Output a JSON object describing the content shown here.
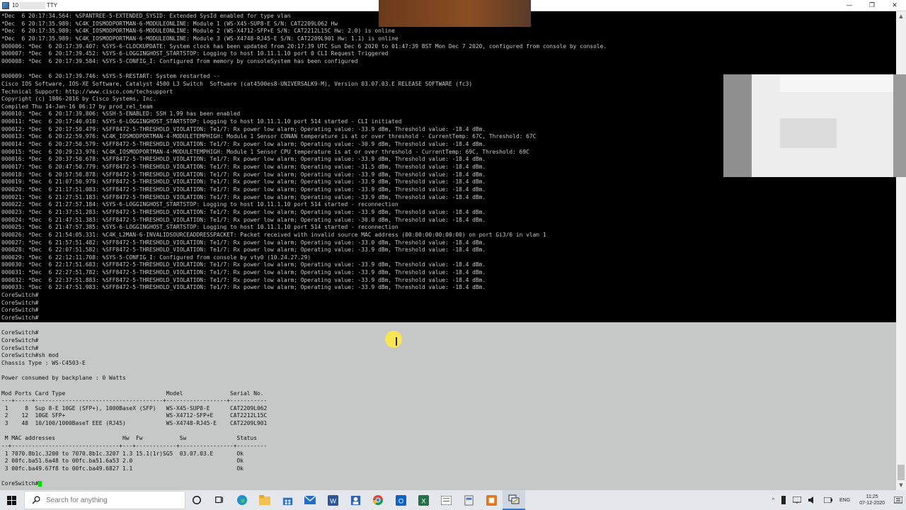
{
  "window": {
    "title_prefix": "10",
    "title_suffix": "TTY",
    "controls": {
      "minimize": "—",
      "maximize": "❐",
      "close": "✕"
    }
  },
  "terminal": {
    "lines": [
      "*Dec  6 20:17:34.564: %SPANTREE-5-EXTENDED_SYSID: Extended SysId enabled for type vlan",
      "*Dec  6 20:17:35.989: %C4K_IOSMODPORTMAN-6-MODULEONLINE: Module 1 (WS-X45-SUP8-E S/N: CAT2209L062 Hw",
      "*Dec  6 20:17:35.989: %C4K_IOSMODPORTMAN-6-MODULEONLINE: Module 2 (WS-X4712-SFP+E S/N: CAT2212L15C Hw: 2.0) is online",
      "*Dec  6 20:17:35.989: %C4K_IOSMODPORTMAN-6-MODULEONLINE: Module 3 (WS-X4748-RJ45-E S/N: CAT2209L901 Hw: 1.1) is online",
      "000006: *Dec  6 20:17:39.407: %SYS-6-CLOCKUPDATE: System clock has been updated from 20:17:39 UTC Sun Dec 6 2020 to 01:47:39 BST Mon Dec 7 2020, configured from console by console.",
      "000007: *Dec  6 20:17:39.452: %SYS-6-LOGGINGHOST_STARTSTOP: Logging to host 10.11.1.10 port 0 CLI Request Triggered",
      "000008: *Dec  6 20:17:39.584: %SYS-5-CONFIG_I: Configured from memory by consoleSystem has been configured",
      "",
      "000009: *Dec  6 20:17:39.746: %SYS-5-RESTART: System restarted --",
      "Cisco IOS Software, IOS-XE Software, Catalyst 4500 L3 Switch  Software (cat4500es8-UNIVERSALK9-M), Version 03.07.03.E RELEASE SOFTWARE (fc3)",
      "Technical Support: http://www.cisco.com/techsupport",
      "Copyright (c) 1986-2016 by Cisco Systems, Inc.",
      "Compiled Thu 14-Jan-16 06:17 by prod_rel_team",
      "000010: *Dec  6 20:17:39.806: %SSH-5-ENABLED: SSH 1.99 has been enabled",
      "000011: *Dec  6 20:17:40.010: %SYS-6-LOGGINGHOST_STARTSTOP: Logging to host 10.11.1.10 port 514 started - CLI initiated",
      "000012: *Dec  6 20:17:50.479: %SFF8472-5-THRESHOLD_VIOLATION: Te1/7: Rx power low alarm; Operating value: -33.9 dBm, Threshold value: -18.4 dBm.",
      "000013: *Dec  6 20:22:59.976: %C4K_IOSMODPORTMAN-4-MODULETEMPHIGH: Module 1 Sensor CONAN temperature is at or over threshold - CurrentTemp: 67C, Threshold: 67C",
      "000014: *Dec  6 20:27:50.579: %SFF8472-5-THRESHOLD_VIOLATION: Te1/7: Rx power low alarm; Operating value: -30.9 dBm, Threshold value: -18.4 dBm.",
      "000015: *Dec  6 20:29:23.976: %C4K_IOSMODPORTMAN-4-MODULETEMPHIGH: Module 1 Sensor CPU temperature is at or over threshold - CurrentTemp: 69C, Threshold: 69C",
      "000016: *Dec  6 20:37:50.678: %SFF8472-5-THRESHOLD_VIOLATION: Te1/7: Rx power low alarm; Operating value: -33.9 dBm, Threshold value: -18.4 dBm.",
      "000017: *Dec  6 20:47:50.779: %SFF8472-5-THRESHOLD_VIOLATION: Te1/7: Rx power low alarm; Operating value: -31.5 dBm, Threshold value: -18.4 dBm.",
      "000018: *Dec  6 20:57:50.878: %SFF8472-5-THRESHOLD_VIOLATION: Te1/7: Rx power low alarm; Operating value: -33.9 dBm, Threshold value: -18.4 dBm.",
      "000019: *Dec  6 21:07:50.979: %SFF8472-5-THRESHOLD_VIOLATION: Te1/7: Rx power low alarm; Operating value: -33.9 dBm, Threshold value: -18.4 dBm.",
      "000020: *Dec  6 21:17:51.083: %SFF8472-5-THRESHOLD_VIOLATION: Te1/7: Rx power low alarm; Operating value: -33.9 dBm, Threshold value: -18.4 dBm.",
      "000021: *Dec  6 21:27:51.183: %SFF8472-5-THRESHOLD_VIOLATION: Te1/7: Rx power low alarm; Operating value: -33.9 dBm, Threshold value: -18.4 dBm.",
      "000022: *Dec  6 21:27:57.184: %SYS-6-LOGGINGHOST_STARTSTOP: Logging to host 10.11.1.10 port 514 started - reconnection",
      "000023: *Dec  6 21:37:51.283: %SFF8472-5-THRESHOLD_VIOLATION: Te1/7: Rx power low alarm; Operating value: -33.9 dBm, Threshold value: -18.4 dBm.",
      "000024: *Dec  6 21:47:51.383: %SFF8472-5-THRESHOLD_VIOLATION: Te1/7: Rx power low alarm; Operating value: -30.0 dBm, Threshold value: -18.4 dBm.",
      "000025: *Dec  6 21:47:57.385: %SYS-6-LOGGINGHOST_STARTSTOP: Logging to host 10.11.1.10 port 514 started - reconnection",
      "000026: *Dec  6 21:54:05.331: %C4K_L2MAN-6-INVALIDSOURCEADDRESSPACKET: Packet received with invalid source MAC address (00:00:00:00:00:00) on port Gi3/6 in vlan 1",
      "000027: *Dec  6 21:57:51.482: %SFF8472-5-THRESHOLD_VIOLATION: Te1/7: Rx power low alarm; Operating value: -33.0 dBm, Threshold value: -18.4 dBm.",
      "000028: *Dec  6 22:07:51.582: %SFF8472-5-THRESHOLD_VIOLATION: Te1/7: Rx power low alarm; Operating value: -33.9 dBm, Threshold value: -18.4 dBm.",
      "000029: *Dec  6 22:12:11.708: %SYS-5-CONFIG_I: Configured from console by vty0 (10.24.27.29)",
      "000030: *Dec  6 22:17:51.683: %SFF8472-5-THRESHOLD_VIOLATION: Te1/7: Rx power low alarm; Operating value: -33.9 dBm, Threshold value: -18.4 dBm.",
      "000031: *Dec  6 22:27:51.782: %SFF8472-5-THRESHOLD_VIOLATION: Te1/7: Rx power low alarm; Operating value: -33.9 dBm, Threshold value: -18.4 dBm.",
      "000032: *Dec  6 22:37:51.883: %SFF8472-5-THRESHOLD_VIOLATION: Te1/7: Rx power low alarm; Operating value: -33.9 dBm, Threshold value: -18.4 dBm.",
      "000033: *Dec  6 22:47:51.983: %SFF8472-5-THRESHOLD_VIOLATION: Te1/7: Rx power low alarm; Operating value: -33.9 dBm, Threshold value: -18.4 dBm.",
      "CoreSwitch#",
      "CoreSwitch#",
      "CoreSwitch#",
      "CoreSwitch#",
      "CoreSwitch#",
      "CoreSwitch#",
      "CoreSwitch#",
      "CoreSwitch#",
      "CoreSwitch#sh mod",
      "Chassis Type : WS-C4503-E",
      "",
      "Power consumed by backplane : 0 Watts",
      "",
      "Mod Ports Card Type                              Model              Serial No.",
      "---+-----+--------------------------------------+------------------+-----------",
      " 1     8  Sup 8-E 10GE (SFP+), 1000BaseX (SFP)   WS-X45-SUP8-E      CAT2209L062",
      " 2    12  10GE SFP+                              WS-X4712-SFP+E     CAT2212L15C",
      " 3    48  10/100/1000BaseT EEE (RJ45)            WS-X4748-RJ45-E    CAT2209L901",
      "",
      " M MAC addresses                    Hw  Fw           Sw               Status",
      "--+--------------------------------+---+------------+----------------+---------",
      " 1 7070.8b1c.3200 to 7070.8b1c.3207 1.3 15.1(1r)SG5  03.07.03.E       Ok",
      " 2 00fc.ba51.6a48 to 00fc.ba51.6a53 2.0                               Ok",
      " 3 00fc.ba49.67f8 to 00fc.ba49.6827 1.1                               Ok",
      "",
      "CoreSwitch#"
    ]
  },
  "scrollbar": {
    "up": "▲",
    "down": "▼"
  },
  "taskbar": {
    "search_placeholder": "Search for anything",
    "icons": [
      "cortana-icon",
      "task-view-icon",
      "edge-icon",
      "file-explorer-icon",
      "store-icon",
      "mail-icon",
      "word-icon",
      "people-icon",
      "chrome-icon",
      "outlook-icon",
      "excel-icon",
      "notes-icon",
      "connection-icon",
      "app-orange-icon",
      "putty-icon"
    ],
    "tray": {
      "chevron": "^",
      "language": "ENG",
      "time": "11:25",
      "date": "07-12-2020"
    }
  },
  "colors": {
    "terminal_bg": "#000000",
    "terminal_fg": "#c8c8c8",
    "selection": "#c6c8c8",
    "cursor": "#00e000",
    "taskbar": "#e4e7ec"
  }
}
